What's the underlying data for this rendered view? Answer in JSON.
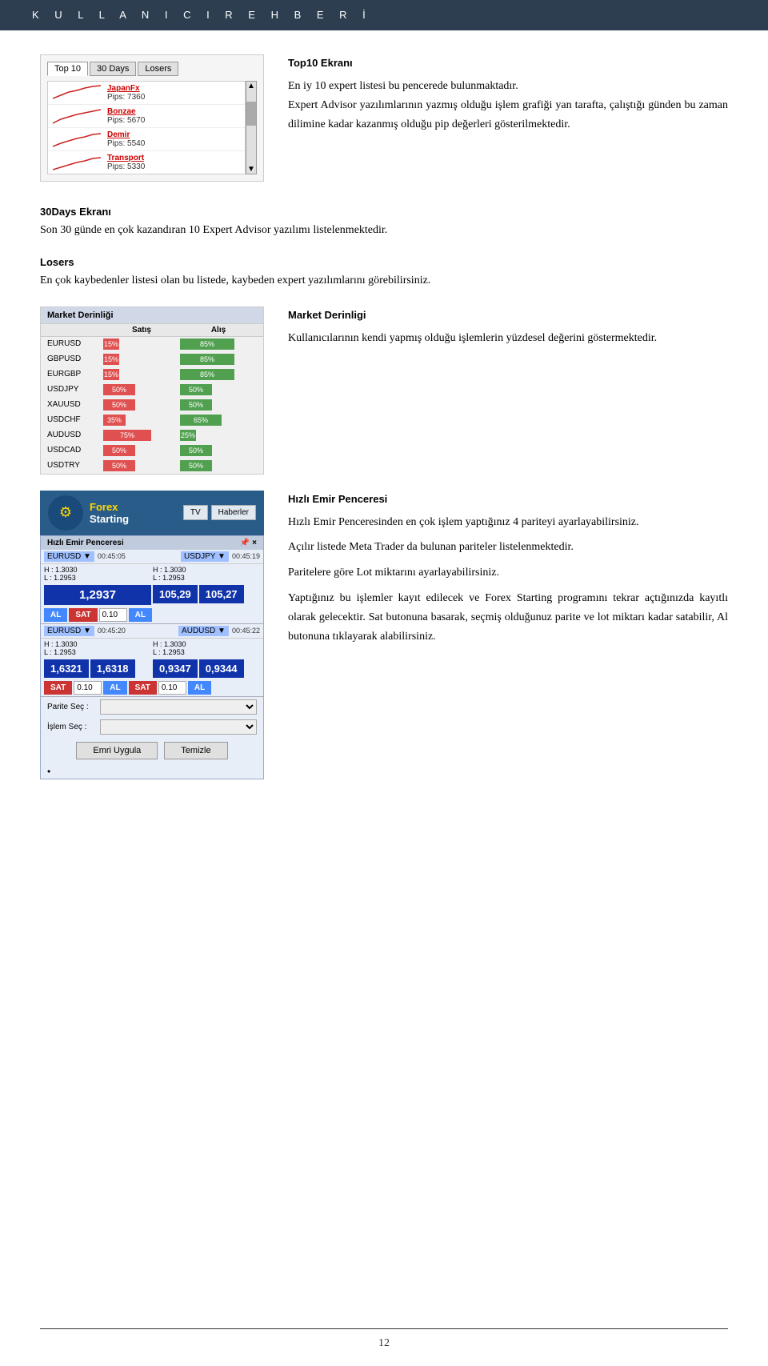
{
  "header": {
    "title": "K U L L A N I C I   R E H B E R İ"
  },
  "top10_section": {
    "heading": "Top10 Ekranı",
    "description_1": "En iy 10 expert listesi bu pencerede bulunmaktadır.",
    "description_2": "Expert Advisor yazılımlarının yazmış olduğu işlem grafiği yan tarafta, çalıştığı günden bu zaman dilimine kadar kazanmış olduğu pip değerleri gösterilmektedir.",
    "tabs": [
      "Top 10",
      "30 Days",
      "Losers"
    ],
    "ea_items": [
      {
        "name": "JapanFx",
        "pips": "Pips: 7360"
      },
      {
        "name": "Bonzae",
        "pips": "Pips: 5670"
      },
      {
        "name": "Demir",
        "pips": "Pips: 5540"
      },
      {
        "name": "Transport",
        "pips": "Pips: 5330"
      }
    ]
  },
  "days30_section": {
    "heading": "30Days Ekranı",
    "description": "Son 30 günde en çok kazandıran 10 Expert Advisor yazılımı listelenmektedir."
  },
  "losers_section": {
    "heading": "Losers",
    "description": "En çok kaybedenler listesi olan bu listede, kaybeden expert yazılımlarını görebilirsiniz."
  },
  "market_section": {
    "heading": "Market Derinligi",
    "description": "Kullanıcılarının kendi yapmış olduğu işlemlerin yüzdesel değerini göstermektedir.",
    "title_bar": "Market Derinliği",
    "col_satis": "Satış",
    "col_alis": "Alış",
    "rows": [
      {
        "pair": "EURUSD",
        "satis": "15%",
        "alis": "85%",
        "satis_w": 15,
        "alis_w": 85
      },
      {
        "pair": "GBPUSD",
        "satis": "15%",
        "alis": "85%",
        "satis_w": 15,
        "alis_w": 85
      },
      {
        "pair": "EURGBP",
        "satis": "15%",
        "alis": "85%",
        "satis_w": 15,
        "alis_w": 85
      },
      {
        "pair": "USDJPY",
        "satis": "50%",
        "alis": "50%",
        "satis_w": 50,
        "alis_w": 50
      },
      {
        "pair": "XAUUSD",
        "satis": "50%",
        "alis": "50%",
        "satis_w": 50,
        "alis_w": 50
      },
      {
        "pair": "USDCHF",
        "satis": "35%",
        "alis": "65%",
        "satis_w": 35,
        "alis_w": 65
      },
      {
        "pair": "AUDUSD",
        "satis": "75%",
        "alis": "25%",
        "satis_w": 75,
        "alis_w": 25
      },
      {
        "pair": "USDCAD",
        "satis": "50%",
        "alis": "50%",
        "satis_w": 50,
        "alis_w": 50
      },
      {
        "pair": "USDTRY",
        "satis": "50%",
        "alis": "50%",
        "satis_w": 50,
        "alis_w": 50
      }
    ]
  },
  "quick_order": {
    "heading": "Hızlı Emir Penceresi",
    "description_1": "Hızlı Emir Penceresinden en çok işlem yaptığınız 4 pariteyi ayarlayabilirsiniz.",
    "description_2": "Açılır listede Meta Trader da bulunan pariteler listelenmektedir.",
    "description_3": "Paritelere göre Lot miktarını ayarlayabilirsiniz.",
    "description_4": "Yaptığınız bu işlemler kayıt edilecek ve Forex Starting programını tekrar açtığınızda kayıtlı olarak gelecektir. Sat butonuna basarak, seçmiş olduğunuz parite ve lot miktarı kadar satabilir, Al butonuna tıklayarak alabilirsiniz.",
    "brand_name": "Forex",
    "brand_sub": "Starting",
    "nav_items": [
      "TV",
      "Haberler"
    ],
    "panel_title": "Hızlı Emir Penceresi",
    "pairs": [
      {
        "pair": "EURUSD",
        "time1": "00:45:05",
        "pair2": "USDJPY",
        "time2": "00:45:19",
        "price1_h": "H : 1.3030",
        "price1_l": "L : 1.2953",
        "price2_h": "H : 1.3030",
        "price2_l": "L : 1.2953",
        "big1": "1,2937",
        "big2": "105,29",
        "big3": "105,27",
        "al_label": "AL",
        "sat_label": "SAT",
        "lot1": "0.10"
      },
      {
        "pair": "EURUSD",
        "time1": "00:45:20",
        "pair2": "AUDUSD",
        "time2": "00:45:22",
        "price1_h": "H : 1.3030",
        "price1_l": "L : 1.2953",
        "price2_h": "H : 1.3030",
        "price2_l": "L : 1.2953",
        "big1": "1,6321",
        "big2": "1,6318",
        "big3": "0,9347",
        "big4": "0,9344",
        "al_label": "AL",
        "sat_label": "SAT",
        "lot2": "0.10"
      }
    ],
    "parite_label": "Parite Seç  :",
    "islem_label": "İşlem Seç  :",
    "emri_uygula": "Emri Uygula",
    "temizle": "Temizle"
  },
  "footer": {
    "page_number": "12"
  }
}
